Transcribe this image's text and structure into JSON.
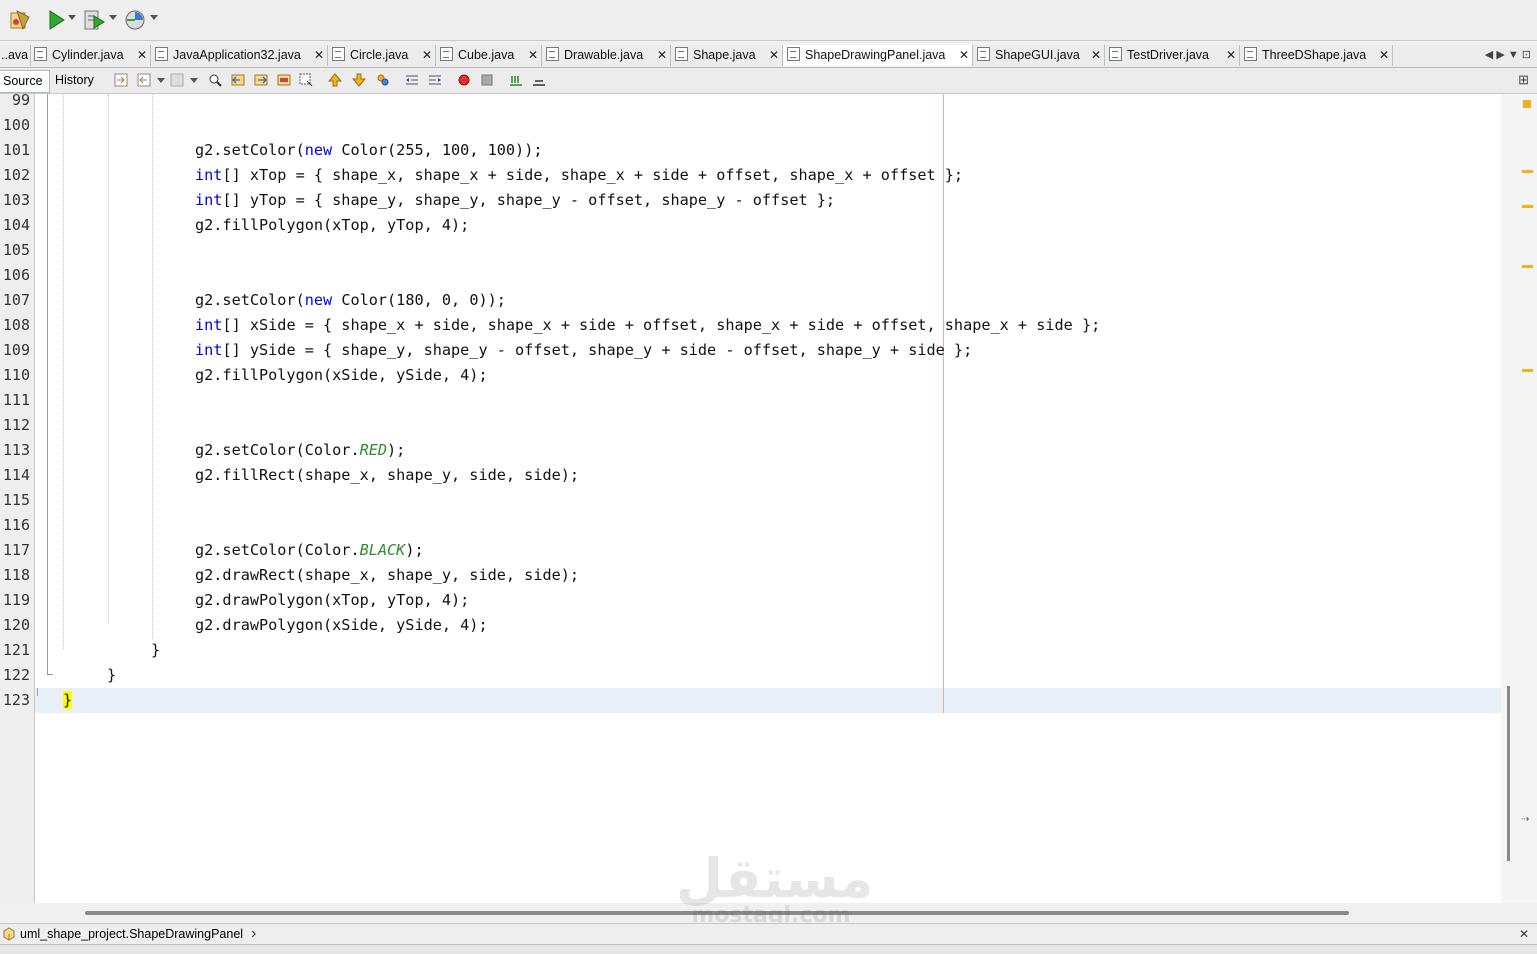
{
  "tabs": [
    {
      "label": "..ava",
      "active": false
    },
    {
      "label": "Cylinder.java",
      "active": false
    },
    {
      "label": "JavaApplication32.java",
      "active": false
    },
    {
      "label": "Circle.java",
      "active": false
    },
    {
      "label": "Cube.java",
      "active": false
    },
    {
      "label": "Drawable.java",
      "active": false
    },
    {
      "label": "Shape.java",
      "active": false
    },
    {
      "label": "ShapeDrawingPanel.java",
      "active": true
    },
    {
      "label": "ShapeGUI.java",
      "active": false
    },
    {
      "label": "TestDriver.java",
      "active": false
    },
    {
      "label": "ThreeDShape.java",
      "active": false
    }
  ],
  "editor_toolbar": {
    "source_label": "Source",
    "history_label": "History"
  },
  "close_glyph": "✕",
  "tab_nav": "◀ ▶ ▼ ⊡",
  "line_numbers": [
    "99",
    "100",
    "101",
    "102",
    "103",
    "104",
    "105",
    "106",
    "107",
    "108",
    "109",
    "110",
    "111",
    "112",
    "113",
    "114",
    "115",
    "116",
    "117",
    "118",
    "119",
    "120",
    "121",
    "122",
    "123"
  ],
  "code": {
    "l101": {
      "a": "g2.setColor(",
      "kw": "new",
      "b": " Color(255, 100, 100));"
    },
    "l102": {
      "kw": "int",
      "b": "[] xTop = { shape_x, shape_x + side, shape_x + side + offset, shape_x + offset };"
    },
    "l103": {
      "kw": "int",
      "b": "[] yTop = { shape_y, shape_y, shape_y - offset, shape_y - offset };"
    },
    "l104": "g2.fillPolygon(xTop, yTop, 4);",
    "l107": {
      "a": "g2.setColor(",
      "kw": "new",
      "b": " Color(180, 0, 0));"
    },
    "l108": {
      "kw": "int",
      "b": "[] xSide = { shape_x + side, shape_x + side + offset, shape_x + side + offset, shape_x + side };"
    },
    "l109": {
      "kw": "int",
      "b": "[] ySide = { shape_y, shape_y - offset, shape_y + side - offset, shape_y + side };"
    },
    "l110": "g2.fillPolygon(xSide, ySide, 4);",
    "l113": {
      "a": "g2.setColor(Color.",
      "const": "RED",
      "b": ");"
    },
    "l114": "g2.fillRect(shape_x, shape_y, side, side);",
    "l117": {
      "a": "g2.setColor(Color.",
      "const": "BLACK",
      "b": ");"
    },
    "l118": "g2.drawRect(shape_x, shape_y, side, side);",
    "l119": "g2.drawPolygon(xTop, yTop, 4);",
    "l120": "g2.drawPolygon(xSide, ySide, 4);",
    "l121": "}",
    "l122": "}",
    "l123": "}"
  },
  "breadcrumb": {
    "path": "uml_shape_project.ShapeDrawingPanel",
    "arrow": "›"
  },
  "watermark": {
    "logo": "مستقل",
    "text": "mostaql.com"
  },
  "colors": {
    "keyword": "#0000e6",
    "constant": "#2e8b2e",
    "current_line": "#e9eff8",
    "brace_highlight": "#ffff00",
    "margin_line": "#f2a8a8",
    "task_mark": "#f0b020"
  }
}
